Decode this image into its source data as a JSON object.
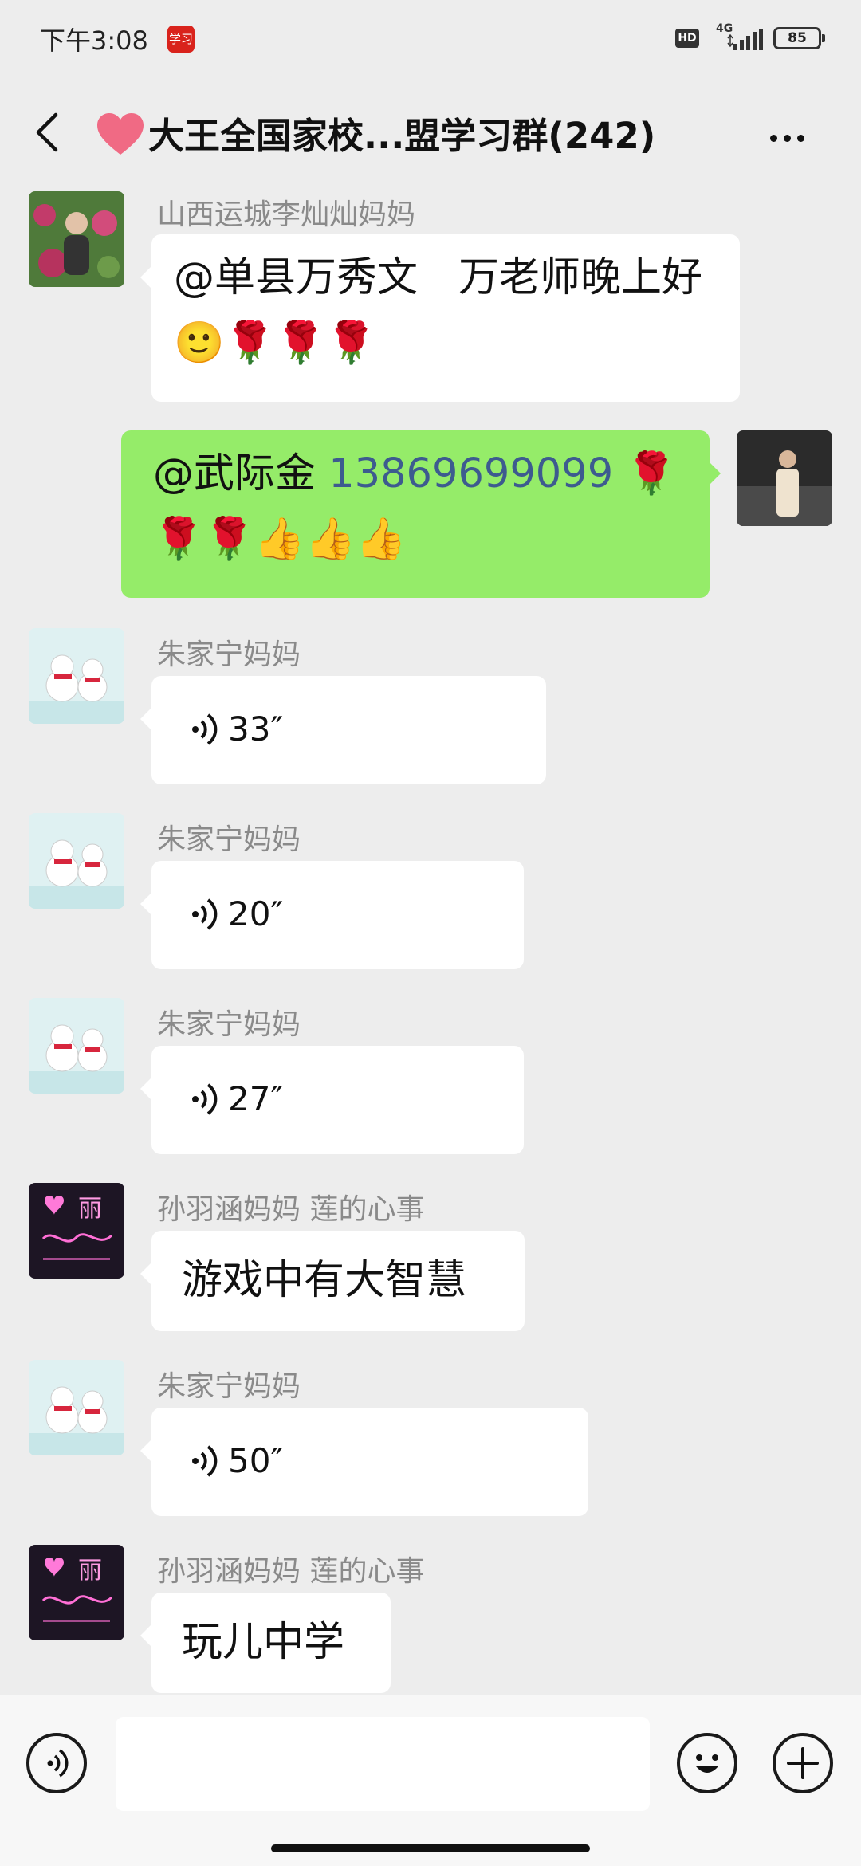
{
  "status_bar": {
    "time": "下午3:08",
    "app_badge": "学习",
    "hd": "HD",
    "network": "4G",
    "battery": "85"
  },
  "header": {
    "title_icon": "heart-icon",
    "title": "大王全国家校...盟学习群(242)"
  },
  "messages": [
    {
      "sender": "山西运城李灿灿妈妈",
      "text": "@单县万秀文　万老师晚上好 🙂🌹🌹🌹"
    },
    {
      "mine": true,
      "mention": "@武际金 ",
      "phone": "13869699099",
      "text_after": " 🌹🌹🌹👍👍👍"
    },
    {
      "sender": "朱家宁妈妈",
      "voice": "33″"
    },
    {
      "sender": "朱家宁妈妈",
      "voice": "20″"
    },
    {
      "sender": "朱家宁妈妈",
      "voice": "27″"
    },
    {
      "sender": "孙羽涵妈妈  莲的心事",
      "text": "游戏中有大智慧"
    },
    {
      "sender": "朱家宁妈妈",
      "voice": "50″"
    },
    {
      "sender": "孙羽涵妈妈  莲的心事",
      "text": "玩儿中学"
    }
  ],
  "avatar_text": {
    "li_avatar_glyph": "丽"
  },
  "icons": {
    "back": "chevron-left-icon",
    "more": "more-dots-icon",
    "voice_input": "voice-icon",
    "emoji": "emoji-icon",
    "plus": "plus-icon"
  },
  "colors": {
    "background": "#ededed",
    "my_bubble": "#95ec69",
    "other_bubble": "#ffffff",
    "link": "#3d5b8f"
  }
}
